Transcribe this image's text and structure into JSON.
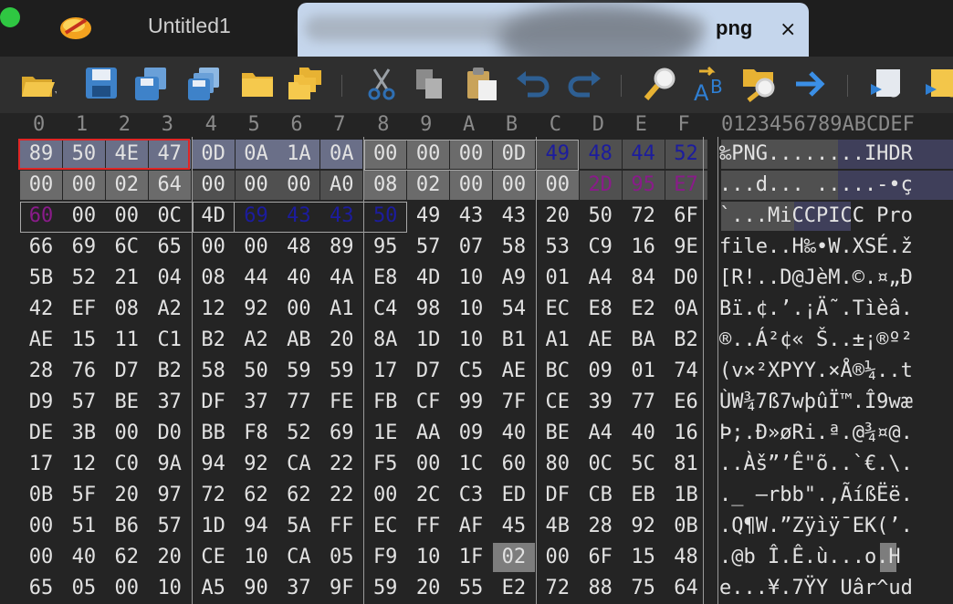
{
  "tabs": [
    {
      "label": "Untitled1",
      "active": false
    },
    {
      "label": "png",
      "active": true,
      "close_glyph": "×"
    }
  ],
  "toolbar": {
    "icons": [
      "open-icon",
      "save-icon",
      "save-as-icon",
      "save-all-icon",
      "folder-icon",
      "folder-multi-icon",
      "cut-icon",
      "copy-icon",
      "paste-icon",
      "undo-icon",
      "redo-icon",
      "find-icon",
      "replace-icon",
      "find-in-files-icon",
      "goto-icon",
      "script-icon",
      "script2-icon"
    ]
  },
  "hex": {
    "column_headers": [
      "0",
      "1",
      "2",
      "3",
      "4",
      "5",
      "6",
      "7",
      "8",
      "9",
      "A",
      "B",
      "C",
      "D",
      "E",
      "F"
    ],
    "text_header": "0123456789ABCDEF",
    "rows": [
      [
        "89",
        "50",
        "4E",
        "47",
        "0D",
        "0A",
        "1A",
        "0A",
        "00",
        "00",
        "00",
        "0D",
        "49",
        "48",
        "44",
        "52"
      ],
      [
        "00",
        "00",
        "02",
        "64",
        "00",
        "00",
        "00",
        "A0",
        "08",
        "02",
        "00",
        "00",
        "00",
        "2D",
        "95",
        "E7"
      ],
      [
        "60",
        "00",
        "00",
        "0C",
        "4D",
        "69",
        "43",
        "43",
        "50",
        "49",
        "43",
        "43",
        "20",
        "50",
        "72",
        "6F"
      ],
      [
        "66",
        "69",
        "6C",
        "65",
        "00",
        "00",
        "48",
        "89",
        "95",
        "57",
        "07",
        "58",
        "53",
        "C9",
        "16",
        "9E"
      ],
      [
        "5B",
        "52",
        "21",
        "04",
        "08",
        "44",
        "40",
        "4A",
        "E8",
        "4D",
        "10",
        "A9",
        "01",
        "A4",
        "84",
        "D0"
      ],
      [
        "42",
        "EF",
        "08",
        "A2",
        "12",
        "92",
        "00",
        "A1",
        "C4",
        "98",
        "10",
        "54",
        "EC",
        "E8",
        "E2",
        "0A"
      ],
      [
        "AE",
        "15",
        "11",
        "C1",
        "B2",
        "A2",
        "AB",
        "20",
        "8A",
        "1D",
        "10",
        "B1",
        "A1",
        "AE",
        "BA",
        "B2"
      ],
      [
        "28",
        "76",
        "D7",
        "B2",
        "58",
        "50",
        "59",
        "59",
        "17",
        "D7",
        "C5",
        "AE",
        "BC",
        "09",
        "01",
        "74"
      ],
      [
        "D9",
        "57",
        "BE",
        "37",
        "DF",
        "37",
        "77",
        "FE",
        "FB",
        "CF",
        "99",
        "7F",
        "CE",
        "39",
        "77",
        "E6"
      ],
      [
        "DE",
        "3B",
        "00",
        "D0",
        "BB",
        "F8",
        "52",
        "69",
        "1E",
        "AA",
        "09",
        "40",
        "BE",
        "A4",
        "40",
        "16"
      ],
      [
        "17",
        "12",
        "C0",
        "9A",
        "94",
        "92",
        "CA",
        "22",
        "F5",
        "00",
        "1C",
        "60",
        "80",
        "0C",
        "5C",
        "81"
      ],
      [
        "0B",
        "5F",
        "20",
        "97",
        "72",
        "62",
        "62",
        "22",
        "00",
        "2C",
        "C3",
        "ED",
        "DF",
        "CB",
        "EB",
        "1B"
      ],
      [
        "00",
        "51",
        "B6",
        "57",
        "1D",
        "94",
        "5A",
        "FF",
        "EC",
        "FF",
        "AF",
        "45",
        "4B",
        "28",
        "92",
        "0B"
      ],
      [
        "00",
        "40",
        "62",
        "20",
        "CE",
        "10",
        "CA",
        "05",
        "F9",
        "10",
        "1F",
        "02",
        "00",
        "6F",
        "15",
        "48"
      ],
      [
        "65",
        "05",
        "00",
        "10",
        "A5",
        "90",
        "37",
        "9F",
        "59",
        "20",
        "55",
        "E2",
        "72",
        "88",
        "75",
        "64"
      ]
    ],
    "text_rows": [
      "‰PNG........IHDR",
      "...d... .....-•ç",
      "`...MiCCPICC Pro",
      "file..H‰•W.XSÉ.ž",
      "[R!..D@JèM.©.¤„Ð",
      "Bï.¢.’.¡Ä˜.Tìèâ.",
      "®..Á²¢« Š..±¡®º²",
      "(v×²XPYY.×Å®¼..t",
      "ÙW¾7ß7wþûÏ™.Î9wæ",
      "Þ;.Ð»øRi.ª.@¾¤@.",
      "..Àš”’Ê\"õ..`€.\\.",
      "._ —rbb\".,ÃíßËë.",
      ".Q¶W.”Zÿìÿ¯EK(’.",
      ".@b Î.Ê.ù...o.H",
      "e...¥.7ŸY Uâr^ud"
    ]
  },
  "colors": {
    "signature_box": "#e02525",
    "chunk_type_blue": "#1c1c9e",
    "crc_purple": "#8a1b8a",
    "active_tab": "#c5d6ec"
  }
}
